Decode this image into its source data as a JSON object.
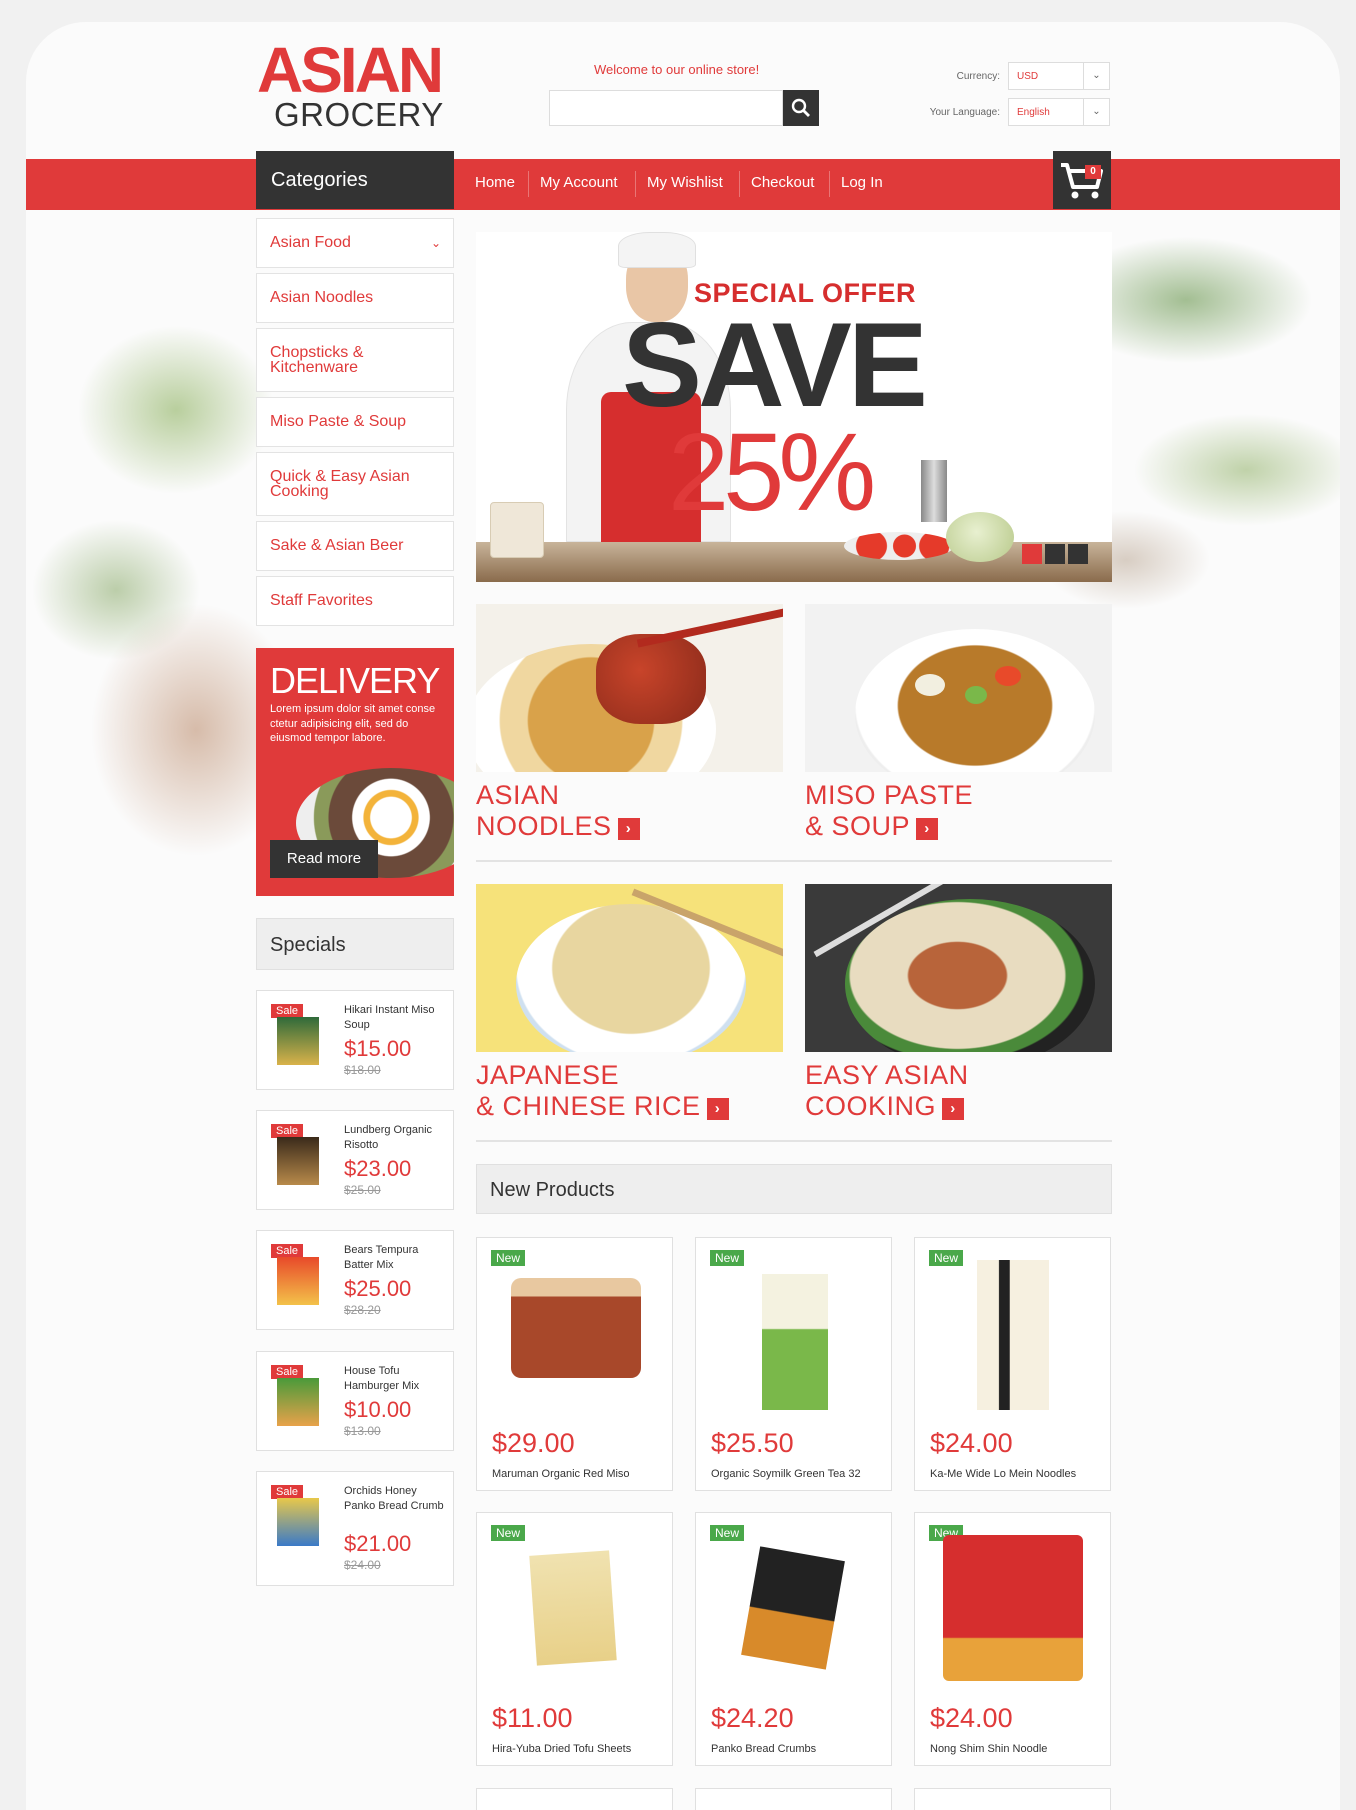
{
  "store": {
    "logo_top": "ASIAN",
    "logo_bottom": "GROCERY",
    "welcome": "Welcome to our online store!",
    "currency_label": "Currency:",
    "currency_value": "USD",
    "language_label": "Your Language:",
    "language_value": "English",
    "cart_count": "0"
  },
  "nav": {
    "categories_title": "Categories",
    "items": [
      "Home",
      "My Account",
      "My Wishlist",
      "Checkout",
      "Log In"
    ]
  },
  "categories": [
    "Asian Food",
    "Asian Noodles",
    "Chopsticks & Kitchenware",
    "Miso Paste & Soup",
    "Quick & Easy Asian Cooking",
    "Sake & Asian Beer",
    "Staff Favorites"
  ],
  "delivery": {
    "title": "DELIVERY",
    "text": "Lorem ipsum dolor sit amet conse ctetur adipisicing elit, sed do eiusmod tempor labore.",
    "button": "Read more"
  },
  "specials": {
    "title": "Specials",
    "badge": "Sale",
    "items": [
      {
        "name": "Hikari Instant Miso Soup",
        "price": "$15.00",
        "old_price": "$18.00"
      },
      {
        "name": "Lundberg Organic Risotto",
        "price": "$23.00",
        "old_price": "$25.00"
      },
      {
        "name": "Bears Tempura Batter Mix",
        "price": "$25.00",
        "old_price": "$28.20"
      },
      {
        "name": "House Tofu Hamburger Mix",
        "price": "$10.00",
        "old_price": "$13.00"
      },
      {
        "name": "Orchids Honey Panko Bread Crumb",
        "price": "$21.00",
        "old_price": "$24.00"
      }
    ]
  },
  "banner": {
    "line1": "SPECIAL OFFER",
    "line2": "SAVE",
    "line3": "25%",
    "slides": 3,
    "active_slide": 1
  },
  "tiles": [
    {
      "line1": "ASIAN",
      "line2": "NOODLES"
    },
    {
      "line1": "MISO PASTE",
      "line2": "& SOUP"
    },
    {
      "line1": "JAPANESE",
      "line2": "& CHINESE RICE"
    },
    {
      "line1": "EASY ASIAN",
      "line2": "COOKING"
    }
  ],
  "new_products": {
    "title": "New Products",
    "badge": "New",
    "items": [
      {
        "price": "$29.00",
        "name": "Maruman Organic Red Miso"
      },
      {
        "price": "$25.50",
        "name": "Organic Soymilk Green Tea 32"
      },
      {
        "price": "$24.00",
        "name": "Ka-Me Wide Lo Mein Noodles"
      },
      {
        "price": "$11.00",
        "name": "Hira-Yuba Dried Tofu Sheets"
      },
      {
        "price": "$24.20",
        "name": "Panko Bread Crumbs"
      },
      {
        "price": "$24.00",
        "name": "Nong Shim Shin Noodle"
      }
    ]
  },
  "colors": {
    "brand_red": "#e03a3a",
    "dark": "#333333",
    "new_green": "#4aa84a"
  }
}
